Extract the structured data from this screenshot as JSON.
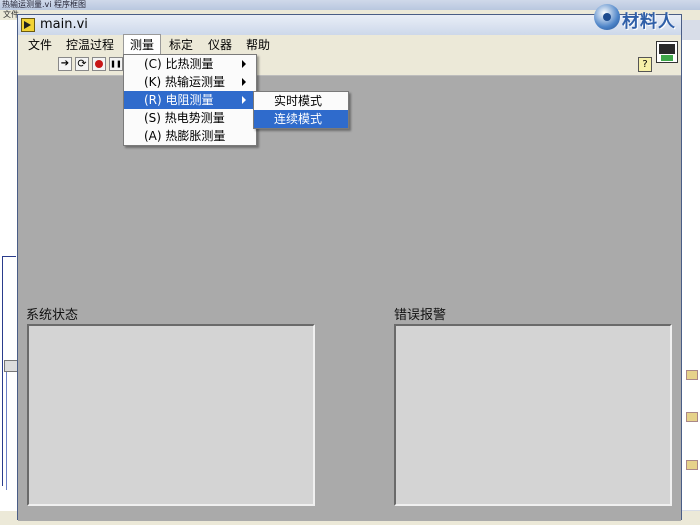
{
  "background_window": {
    "title": "热输运测量.vi 程序框图",
    "menu": "文件"
  },
  "logo": {
    "text": "材料人"
  },
  "window": {
    "title": "main.vi",
    "menu": [
      {
        "label": "文件"
      },
      {
        "label": "控温过程"
      },
      {
        "label": "测量"
      },
      {
        "label": "标定"
      },
      {
        "label": "仪器"
      },
      {
        "label": "帮助"
      }
    ],
    "toolbar": {
      "run_icon": "run-arrow-icon",
      "run_continuous_icon": "run-continuously-icon",
      "abort_icon": "abort-icon",
      "pause_icon": "pause-icon",
      "help_label": "?"
    }
  },
  "measure_menu": {
    "items": [
      {
        "label": "(C) 比热测量",
        "submenu": true
      },
      {
        "label": "(K) 热输运测量",
        "submenu": true
      },
      {
        "label": "(R) 电阻测量",
        "submenu": true,
        "highlighted": true
      },
      {
        "label": "(S) 热电势测量",
        "submenu": false
      },
      {
        "label": "(A) 热膨胀测量",
        "submenu": false
      }
    ]
  },
  "resistance_submenu": {
    "items": [
      {
        "label": "实时模式",
        "highlighted": false
      },
      {
        "label": "连续模式",
        "highlighted": true
      }
    ]
  },
  "panels": {
    "status_label": "系统状态",
    "error_label": "错误报警"
  },
  "colors": {
    "highlight": "#2f6bcc",
    "panel_background": "#aaaaaa",
    "textbox": "#d4d4d4"
  }
}
